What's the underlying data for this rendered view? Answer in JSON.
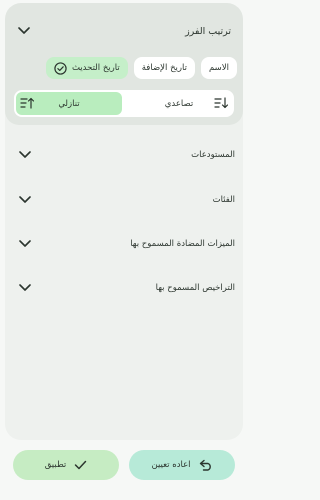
{
  "sort": {
    "title": "ترتيب الفرز",
    "fields": [
      {
        "label": "الاسم",
        "selected": false
      },
      {
        "label": "تاريخ الإضافة",
        "selected": false
      },
      {
        "label": "تاريخ التحديث",
        "selected": true
      }
    ],
    "order": {
      "ascending_label": "تصاعدي",
      "descending_label": "تنازلي",
      "selected": "descending"
    }
  },
  "filters": [
    {
      "label": "المستودعات",
      "icon": "chevron-down-icon"
    },
    {
      "label": "الفئات",
      "icon": "chevron-down-icon"
    },
    {
      "label": "الميزات المضادة المسموح بها",
      "icon": "chevron-down-icon"
    },
    {
      "label": "التراخيص المسموح بها",
      "icon": "chevron-down-icon"
    }
  ],
  "actions": {
    "reset_label": "اعاده تعيين",
    "apply_label": "تطبيق"
  },
  "colors": {
    "selected_chip": "#c5efc9",
    "selected_order": "#b9edbe",
    "reset_button": "#b7ead8",
    "apply_button": "#c6ecc3"
  }
}
